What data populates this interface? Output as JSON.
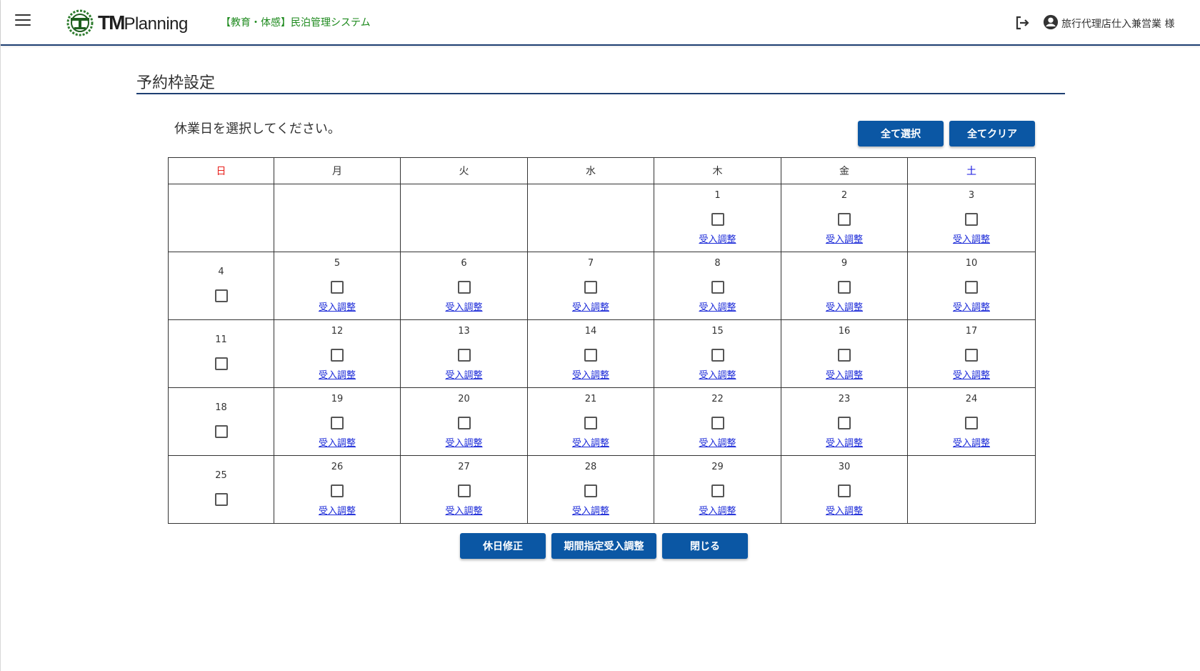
{
  "header": {
    "logo_bold": "TM",
    "logo_text": "Planning",
    "system_name": "【教育・体感】民泊管理システム",
    "user_name": "旅行代理店仕入兼営業 様"
  },
  "page": {
    "title": "予約枠設定",
    "instruction": "休業日を選択してください。",
    "select_all_label": "全て選択",
    "clear_all_label": "全てクリア",
    "holiday_fix_label": "休日修正",
    "period_adjust_label": "期間指定受入調整",
    "close_label": "閉じる"
  },
  "calendar": {
    "weekdays": [
      "日",
      "月",
      "火",
      "水",
      "木",
      "金",
      "土"
    ],
    "link_label": "受入調整",
    "weeks": [
      [
        null,
        null,
        null,
        null,
        "1",
        "2",
        "3"
      ],
      [
        "4",
        "5",
        "6",
        "7",
        "8",
        "9",
        "10"
      ],
      [
        "11",
        "12",
        "13",
        "14",
        "15",
        "16",
        "17"
      ],
      [
        "18",
        "19",
        "20",
        "21",
        "22",
        "23",
        "24"
      ],
      [
        "25",
        "26",
        "27",
        "28",
        "29",
        "30",
        null
      ]
    ]
  },
  "colors": {
    "primary": "#0b57a4",
    "header_border": "#1e3f72",
    "sunday": "#e8201c",
    "saturday": "#1515e0",
    "link": "#1a29d8",
    "system_name": "#1e8a1e"
  }
}
